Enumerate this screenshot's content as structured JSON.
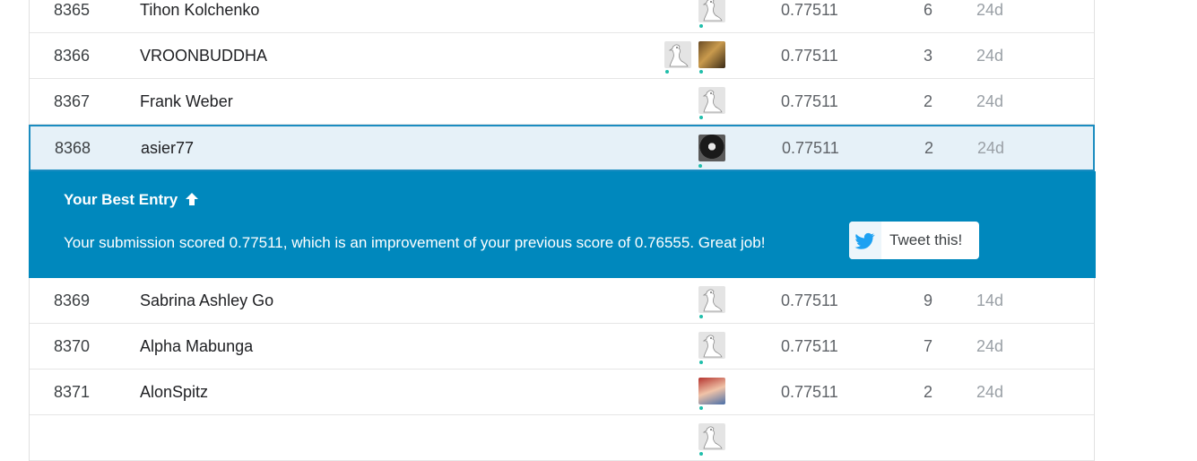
{
  "rows_before": [
    {
      "rank": "8365",
      "name": "Tihon Kolchenko",
      "score": "0.77511",
      "entries": "6",
      "last": "24d",
      "avatars": [
        "goose"
      ]
    },
    {
      "rank": "8366",
      "name": "VROONBUDDHA",
      "score": "0.77511",
      "entries": "3",
      "last": "24d",
      "avatars": [
        "goose",
        "photo-a"
      ]
    },
    {
      "rank": "8367",
      "name": "Frank Weber",
      "score": "0.77511",
      "entries": "2",
      "last": "24d",
      "avatars": [
        "goose"
      ]
    }
  ],
  "my_row": {
    "rank": "8368",
    "name": "asier77",
    "score": "0.77511",
    "entries": "2",
    "last": "24d",
    "avatars": [
      "photo-b"
    ]
  },
  "banner": {
    "title": "Your Best Entry",
    "title_icon": "arrow-up-icon",
    "message": "Your submission scored 0.77511, which is an improvement of your previous score of 0.76555. Great job!",
    "tweet_label": "Tweet this!",
    "tweet_icon": "twitter-bird-icon"
  },
  "rows_after": [
    {
      "rank": "8369",
      "name": "Sabrina Ashley Go",
      "score": "0.77511",
      "entries": "9",
      "last": "14d",
      "avatars": [
        "goose"
      ]
    },
    {
      "rank": "8370",
      "name": "Alpha Mabunga",
      "score": "0.77511",
      "entries": "7",
      "last": "24d",
      "avatars": [
        "goose"
      ]
    },
    {
      "rank": "8371",
      "name": "AlonSpitz",
      "score": "0.77511",
      "entries": "2",
      "last": "24d",
      "avatars": [
        "photo-c"
      ]
    },
    {
      "rank": "",
      "name": "",
      "score": "",
      "entries": "",
      "last": "",
      "avatars": [
        "goose"
      ]
    }
  ],
  "colors": {
    "accent": "#0088bd",
    "highlight_row": "#e6f1f8",
    "highlight_border": "#1b8cc0",
    "online_dot": "#20beab"
  }
}
